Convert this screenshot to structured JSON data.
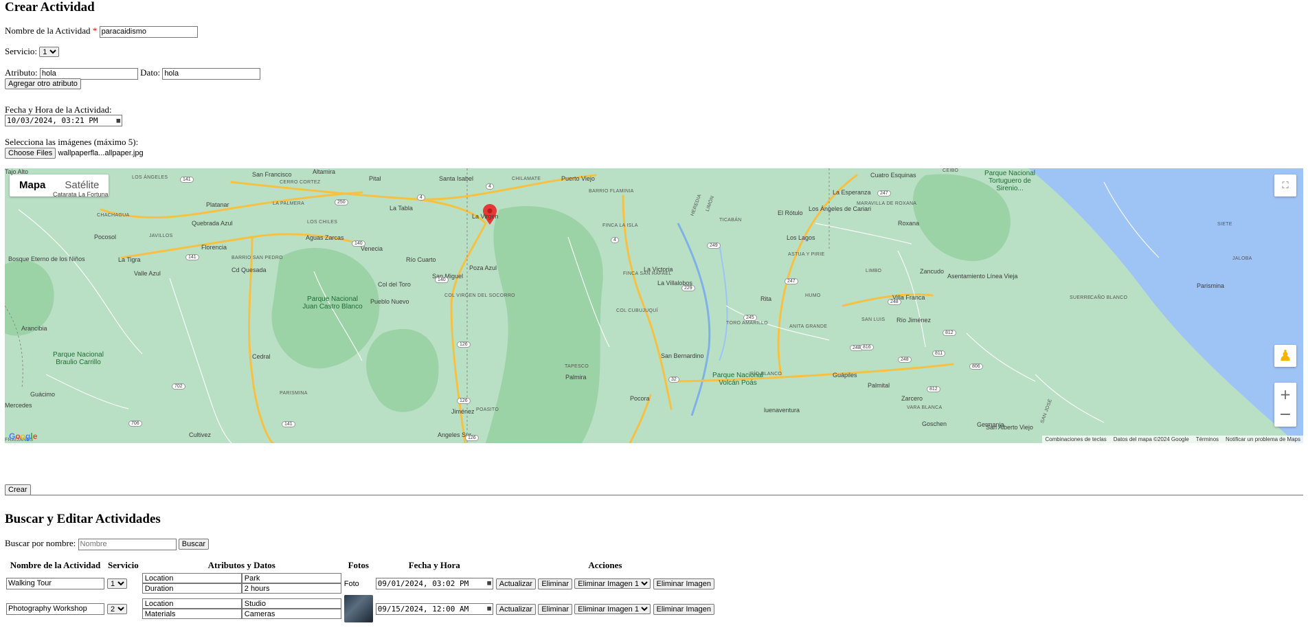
{
  "form": {
    "title": "Crear Actividad",
    "name_label": "Nombre de la Actividad",
    "required_mark": "*",
    "name_value": "paracaidismo",
    "service_label": "Servicio:",
    "service_value": "1",
    "attribute_label": "Atributo:",
    "attribute_value": "hola",
    "data_label": "Dato:",
    "data_value": "hola",
    "add_attribute_button": "Agregar otro atributo",
    "datetime_label": "Fecha y Hora de la Actividad:",
    "datetime_value": "10/03/2024, 03:21 PM",
    "images_label": "Selecciona las imágenes (máximo 5):",
    "choose_files_button": "Choose Files",
    "chosen_file": "wallpaperfla...allpaper.jpg",
    "create_button": "Crear"
  },
  "map": {
    "tab_map": "Mapa",
    "tab_satellite": "Satélite",
    "marker_place": "La Virgen",
    "attribution": [
      "Combinaciones de teclas",
      "Datos del mapa ©2024 Google",
      "Términos",
      "Notificar un problema de Maps"
    ],
    "logo": "Google",
    "places": [
      {
        "name": "San Francisco"
      },
      {
        "name": "Altamira"
      },
      {
        "name": "Pital"
      },
      {
        "name": "Santa Isabel"
      },
      {
        "name": "CHILAMATE"
      },
      {
        "name": "Puerto Viejo"
      },
      {
        "name": "Cuatro Esquinas"
      },
      {
        "name": "CEIBO"
      },
      {
        "name": "Parque Nacional Tortuguero de Sirenio..."
      },
      {
        "name": "LOS ÁNGELES"
      },
      {
        "name": "Catarata La Fortuna"
      },
      {
        "name": "CERRO CORTEZ"
      },
      {
        "name": "Platanar"
      },
      {
        "name": "LA PALMERA"
      },
      {
        "name": "La Tabla"
      },
      {
        "name": "La Virgen"
      },
      {
        "name": "BARRIO FLAMINIA"
      },
      {
        "name": "HEREDIA"
      },
      {
        "name": "LIMÓN"
      },
      {
        "name": "La Esperanza"
      },
      {
        "name": "El Rótulo"
      },
      {
        "name": "Los Ángeles de Cariari"
      },
      {
        "name": "MARAVILLA DE ROXANA"
      },
      {
        "name": "Roxana"
      },
      {
        "name": "CHACHAGUA"
      },
      {
        "name": "Quebrada Azul"
      },
      {
        "name": "LOS CHILES"
      },
      {
        "name": "TICABÁN"
      },
      {
        "name": "FINCA LA ISLA"
      },
      {
        "name": "SIETE"
      },
      {
        "name": "Pocosol"
      },
      {
        "name": "JAVILLOS"
      },
      {
        "name": "Aguas Zarcas"
      },
      {
        "name": "Los Lagos"
      },
      {
        "name": "Florencia"
      },
      {
        "name": "Venecia"
      },
      {
        "name": "ASTUA Y PIRIE"
      },
      {
        "name": "Bosque Eterno de los Niños"
      },
      {
        "name": "La Tigra"
      },
      {
        "name": "BARRIO SAN PEDRO"
      },
      {
        "name": "Río Cuarto"
      },
      {
        "name": "JALOBA"
      },
      {
        "name": "Cd Quesada"
      },
      {
        "name": "Poza Azul"
      },
      {
        "name": "La Victoria"
      },
      {
        "name": "Valle Azul"
      },
      {
        "name": "San Miguel"
      },
      {
        "name": "FINCA SAN RAFAEL"
      },
      {
        "name": "LIMBO"
      },
      {
        "name": "Zancudo"
      },
      {
        "name": "Asentamiento Línea Vieja"
      },
      {
        "name": "La Villalobos"
      },
      {
        "name": "Col del Toro"
      },
      {
        "name": "Parismina"
      },
      {
        "name": "Parque Nacional Juan Castro Blanco"
      },
      {
        "name": "Pueblo Nuevo"
      },
      {
        "name": "COL VIRGEN DEL SOCORRO"
      },
      {
        "name": "HUMO"
      },
      {
        "name": "Rita"
      },
      {
        "name": "Villa Franca"
      },
      {
        "name": "SUERRE"
      },
      {
        "name": "CAÑO BLANCO"
      },
      {
        "name": "COL CUBUJUQUÍ"
      },
      {
        "name": "SAN LUIS"
      },
      {
        "name": "Río Jiménez"
      },
      {
        "name": "Arancibia"
      },
      {
        "name": "TORO AMARILLO"
      },
      {
        "name": "ANITA GRANDE"
      },
      {
        "name": "San Bernardino"
      },
      {
        "name": "TAPESCO"
      },
      {
        "name": "Parque Nacional Braulio Carrillo"
      },
      {
        "name": "Cedral"
      },
      {
        "name": "Palmira"
      },
      {
        "name": "Parque Nacional Volcán Poás"
      },
      {
        "name": "RÍO BLANCO"
      },
      {
        "name": "Guápiles"
      },
      {
        "name": "Guácimo"
      },
      {
        "name": "Palmital"
      },
      {
        "name": "PARISMINA"
      },
      {
        "name": "Zarcero"
      },
      {
        "name": "Mercedes"
      },
      {
        "name": "luenaventura"
      },
      {
        "name": "Jiménez"
      },
      {
        "name": "POASITO"
      },
      {
        "name": "VARA BLANCA"
      },
      {
        "name": "Pocora"
      },
      {
        "name": "SAN JOSÉ"
      },
      {
        "name": "Goschen"
      },
      {
        "name": "Germania"
      },
      {
        "name": "San Alberto Viejo"
      },
      {
        "name": "Cultivez"
      },
      {
        "name": "Angeles Sur"
      },
      {
        "name": "FRAIJANES"
      },
      {
        "name": "Tajo Alto"
      }
    ],
    "road_numbers": [
      "141",
      "250",
      "4",
      "4",
      "140",
      "140",
      "126",
      "126",
      "126",
      "4",
      "32",
      "229",
      "247",
      "247",
      "249",
      "248",
      "248",
      "248",
      "816",
      "811",
      "812",
      "812",
      "806",
      "702",
      "706",
      "141",
      "141",
      "245"
    ]
  },
  "search": {
    "title": "Buscar y Editar Actividades",
    "label": "Buscar por nombre:",
    "placeholder": "Nombre",
    "button": "Buscar"
  },
  "table": {
    "headers": [
      "Nombre de la Actividad",
      "Servicio",
      "Atributos y Datos",
      "Fotos",
      "Fecha y Hora",
      "Acciones"
    ],
    "rows": [
      {
        "name": "Walking Tour",
        "service": "1",
        "attributes": [
          {
            "key": "Location",
            "value": "Park"
          },
          {
            "key": "Duration",
            "value": "2 hours"
          }
        ],
        "photo_alt": "Foto",
        "datetime": "09/01/2024, 03:02 PM",
        "update": "Actualizar",
        "delete": "Eliminar",
        "delete_image_select": "Eliminar Imagen 1",
        "delete_image_button": "Eliminar Imagen"
      },
      {
        "name": "Photography Workshop",
        "service": "2",
        "attributes": [
          {
            "key": "Location",
            "value": "Studio"
          },
          {
            "key": "Materials",
            "value": "Cameras"
          }
        ],
        "photo_alt": "",
        "datetime": "09/15/2024, 12:00 AM",
        "update": "Actualizar",
        "delete": "Eliminar",
        "delete_image_select": "Eliminar Imagen 1",
        "delete_image_button": "Eliminar Imagen"
      }
    ]
  },
  "colors": {
    "map_land": "#b9e0c4",
    "map_park": "#8fcf9c",
    "map_sea": "#9ec3f5",
    "marker": "#e53935",
    "road": "#f6c142"
  }
}
